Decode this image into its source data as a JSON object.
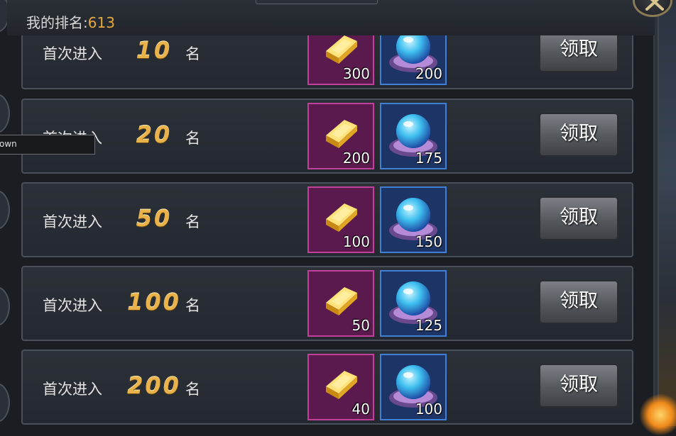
{
  "header": {
    "rank_label": "我的排名:",
    "rank_value": "613"
  },
  "rows": [
    {
      "label": "首次进入",
      "rank": "10",
      "suffix": "名",
      "gold_qty": "300",
      "pearl_qty": "200",
      "button": "领取"
    },
    {
      "label": "首次进入",
      "rank": "20",
      "suffix": "名",
      "gold_qty": "200",
      "pearl_qty": "175",
      "button": "领取"
    },
    {
      "label": "首次进入",
      "rank": "50",
      "suffix": "名",
      "gold_qty": "100",
      "pearl_qty": "150",
      "button": "领取"
    },
    {
      "label": "首次进入",
      "rank": "100",
      "suffix": "名",
      "gold_qty": "50",
      "pearl_qty": "125",
      "button": "领取"
    },
    {
      "label": "首次进入",
      "rank": "200",
      "suffix": "名",
      "gold_qty": "40",
      "pearl_qty": "100",
      "button": "领取"
    }
  ],
  "tooltip": {
    "text": "own"
  },
  "icons": {
    "reward_1": "gold-ingot-icon",
    "reward_2": "pearl-orb-icon",
    "close": "close-icon"
  },
  "colors": {
    "rank_value": "#e7a93a",
    "rank_number": "#e9b24a",
    "gold_slot": "#5a1a4e",
    "pearl_slot": "#1c3466"
  }
}
